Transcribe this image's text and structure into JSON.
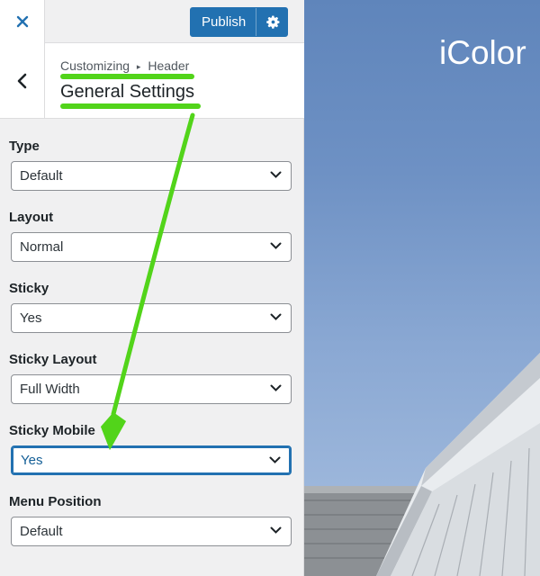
{
  "topbar": {
    "close_icon": "close-icon",
    "publish_label": "Publish",
    "publish_gear_icon": "gear-icon"
  },
  "section": {
    "back_icon": "chevron-left-icon",
    "breadcrumb_prefix": "Customizing",
    "breadcrumb_separator": "▸",
    "breadcrumb_current": "Header",
    "title": "General Settings"
  },
  "controls": [
    {
      "label": "Type",
      "value": "Default"
    },
    {
      "label": "Layout",
      "value": "Normal"
    },
    {
      "label": "Sticky",
      "value": "Yes"
    },
    {
      "label": "Sticky Layout",
      "value": "Full Width"
    },
    {
      "label": "Sticky Mobile",
      "value": "Yes",
      "focused": true
    },
    {
      "label": "Menu Position",
      "value": "Default"
    }
  ],
  "preview": {
    "site_title": "iColor"
  },
  "colors": {
    "accent": "#2271b1",
    "highlight": "#52d41a",
    "sidebar_bg": "#f0f0f1",
    "sky": "#6e91c4"
  }
}
